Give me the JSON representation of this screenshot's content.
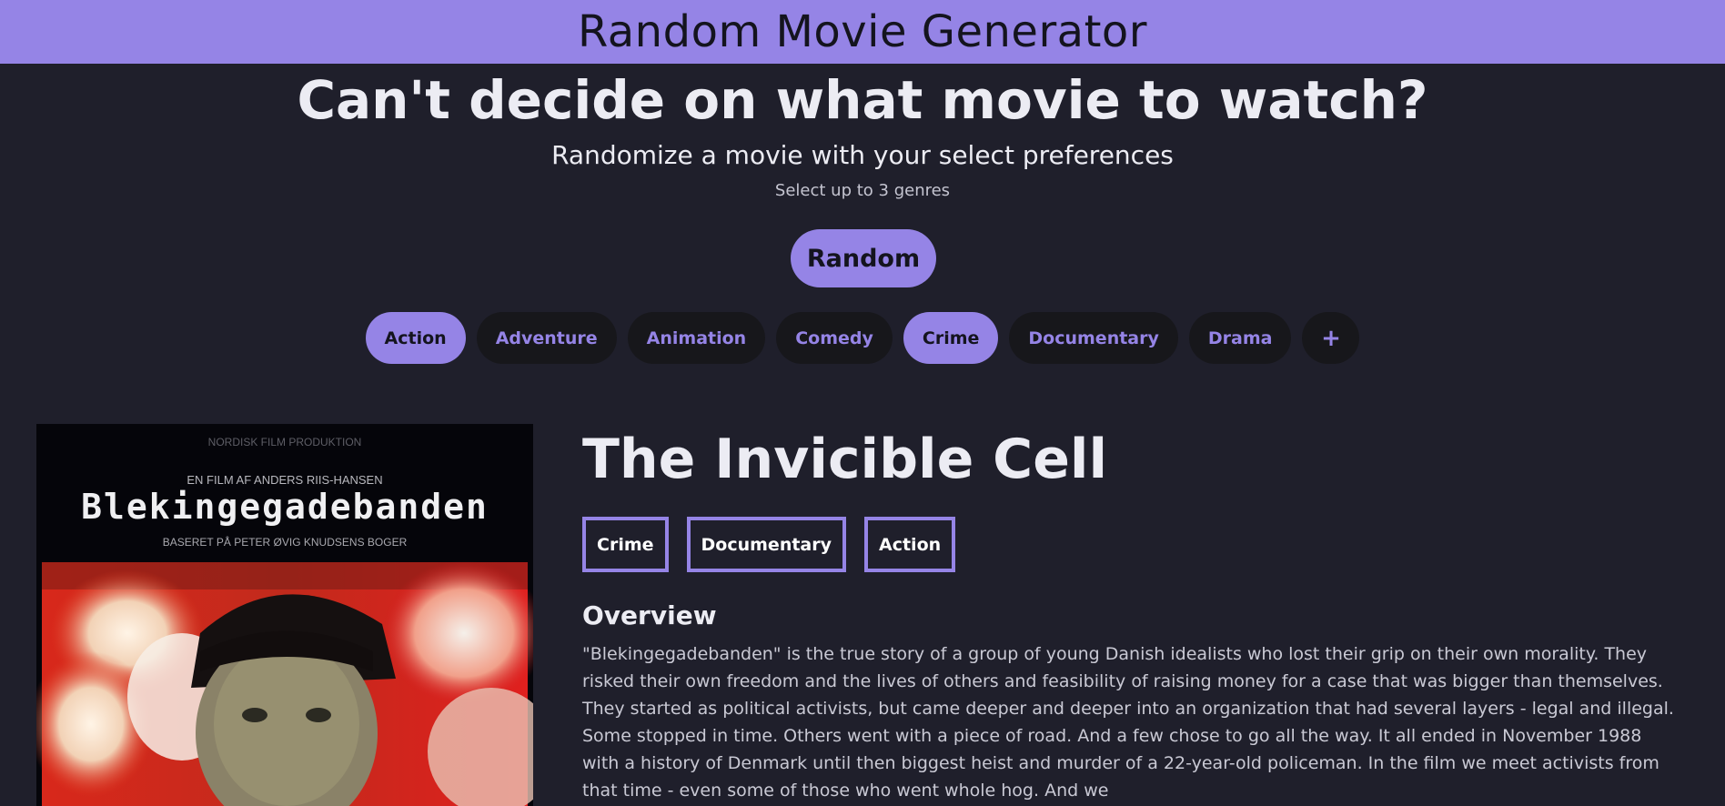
{
  "header": {
    "title": "Random Movie Generator"
  },
  "hero": {
    "title": "Can't decide on what movie to watch?",
    "subtitle": "Randomize a movie with your select preferences",
    "hint": "Select up to 3 genres",
    "random_button": "Random"
  },
  "genres": [
    {
      "label": "Action",
      "selected": true
    },
    {
      "label": "Adventure",
      "selected": false
    },
    {
      "label": "Animation",
      "selected": false
    },
    {
      "label": "Comedy",
      "selected": false
    },
    {
      "label": "Crime",
      "selected": true
    },
    {
      "label": "Documentary",
      "selected": false
    },
    {
      "label": "Drama",
      "selected": false
    }
  ],
  "more_genres_label": "+",
  "movie": {
    "title": "The Invicible Cell",
    "poster": {
      "top_credit": "NORDISK FILM PRODUKTION",
      "director_line": "EN FILM AF ANDERS RIIS-HANSEN",
      "poster_title": "Blekingegadebanden",
      "based_on": "BASERET PÅ PETER ØVIG KNUDSENS BOGER"
    },
    "tags": [
      "Crime",
      "Documentary",
      "Action"
    ],
    "overview_heading": "Overview",
    "overview": "\"Blekingegadebanden\" is the true story of a group of young Danish idealists who lost their grip on their own morality. They risked their own freedom and the lives of others and feasibility of raising money for a case that was bigger than themselves. They started as political activists, but came deeper and deeper into an organization that had several layers - legal and illegal. Some stopped in time. Others went with a piece of road. And a few chose to go all the way. It all ended in November 1988 with a history of Denmark until then biggest heist and murder of a 22-year-old policeman. In the film we meet activists from that time - even some of those who went whole hog. And we"
  },
  "colors": {
    "accent": "#9584e6",
    "background": "#1f1f2b",
    "chip_background": "#17171b",
    "text": "#ececf3"
  }
}
